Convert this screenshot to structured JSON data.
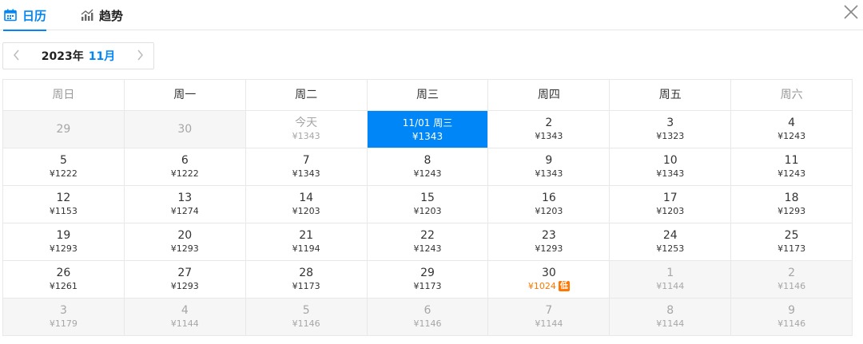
{
  "tabs": [
    {
      "label": "日历",
      "icon": "calendar-icon",
      "active": true
    },
    {
      "label": "趋势",
      "icon": "trend-chart-icon",
      "active": false
    }
  ],
  "colors": {
    "accent": "#0086f6",
    "low": "#ff7700",
    "muted_bg": "#f6f6f6"
  },
  "month_nav": {
    "year": "2023年",
    "month": "11月"
  },
  "weekdays": [
    "周日",
    "周一",
    "周二",
    "周三",
    "周四",
    "周五",
    "周六"
  ],
  "weeks": [
    [
      {
        "d": "29",
        "p": "",
        "state": "muted"
      },
      {
        "d": "30",
        "p": "",
        "state": "muted"
      },
      {
        "d": "今天",
        "p": "¥1343",
        "state": "past"
      },
      {
        "d": "11/01 周三",
        "p": "¥1343",
        "state": "selected"
      },
      {
        "d": "2",
        "p": "¥1343",
        "state": ""
      },
      {
        "d": "3",
        "p": "¥1323",
        "state": ""
      },
      {
        "d": "4",
        "p": "¥1243",
        "state": ""
      }
    ],
    [
      {
        "d": "5",
        "p": "¥1222",
        "state": ""
      },
      {
        "d": "6",
        "p": "¥1222",
        "state": ""
      },
      {
        "d": "7",
        "p": "¥1343",
        "state": ""
      },
      {
        "d": "8",
        "p": "¥1243",
        "state": ""
      },
      {
        "d": "9",
        "p": "¥1343",
        "state": ""
      },
      {
        "d": "10",
        "p": "¥1343",
        "state": ""
      },
      {
        "d": "11",
        "p": "¥1243",
        "state": ""
      }
    ],
    [
      {
        "d": "12",
        "p": "¥1153",
        "state": ""
      },
      {
        "d": "13",
        "p": "¥1274",
        "state": ""
      },
      {
        "d": "14",
        "p": "¥1203",
        "state": ""
      },
      {
        "d": "15",
        "p": "¥1203",
        "state": ""
      },
      {
        "d": "16",
        "p": "¥1203",
        "state": ""
      },
      {
        "d": "17",
        "p": "¥1203",
        "state": ""
      },
      {
        "d": "18",
        "p": "¥1293",
        "state": ""
      }
    ],
    [
      {
        "d": "19",
        "p": "¥1293",
        "state": ""
      },
      {
        "d": "20",
        "p": "¥1293",
        "state": ""
      },
      {
        "d": "21",
        "p": "¥1194",
        "state": ""
      },
      {
        "d": "22",
        "p": "¥1243",
        "state": ""
      },
      {
        "d": "23",
        "p": "¥1293",
        "state": ""
      },
      {
        "d": "24",
        "p": "¥1253",
        "state": ""
      },
      {
        "d": "25",
        "p": "¥1173",
        "state": ""
      }
    ],
    [
      {
        "d": "26",
        "p": "¥1261",
        "state": ""
      },
      {
        "d": "27",
        "p": "¥1293",
        "state": ""
      },
      {
        "d": "28",
        "p": "¥1173",
        "state": ""
      },
      {
        "d": "29",
        "p": "¥1173",
        "state": ""
      },
      {
        "d": "30",
        "p": "¥1024",
        "state": "low",
        "badge": "低"
      },
      {
        "d": "1",
        "p": "¥1144",
        "state": "muted"
      },
      {
        "d": "2",
        "p": "¥1146",
        "state": "muted"
      }
    ],
    [
      {
        "d": "3",
        "p": "¥1179",
        "state": "muted"
      },
      {
        "d": "4",
        "p": "¥1144",
        "state": "muted"
      },
      {
        "d": "5",
        "p": "¥1146",
        "state": "muted"
      },
      {
        "d": "6",
        "p": "¥1146",
        "state": "muted"
      },
      {
        "d": "7",
        "p": "¥1144",
        "state": "muted"
      },
      {
        "d": "8",
        "p": "¥1144",
        "state": "muted"
      },
      {
        "d": "9",
        "p": "¥1146",
        "state": "muted"
      }
    ]
  ]
}
